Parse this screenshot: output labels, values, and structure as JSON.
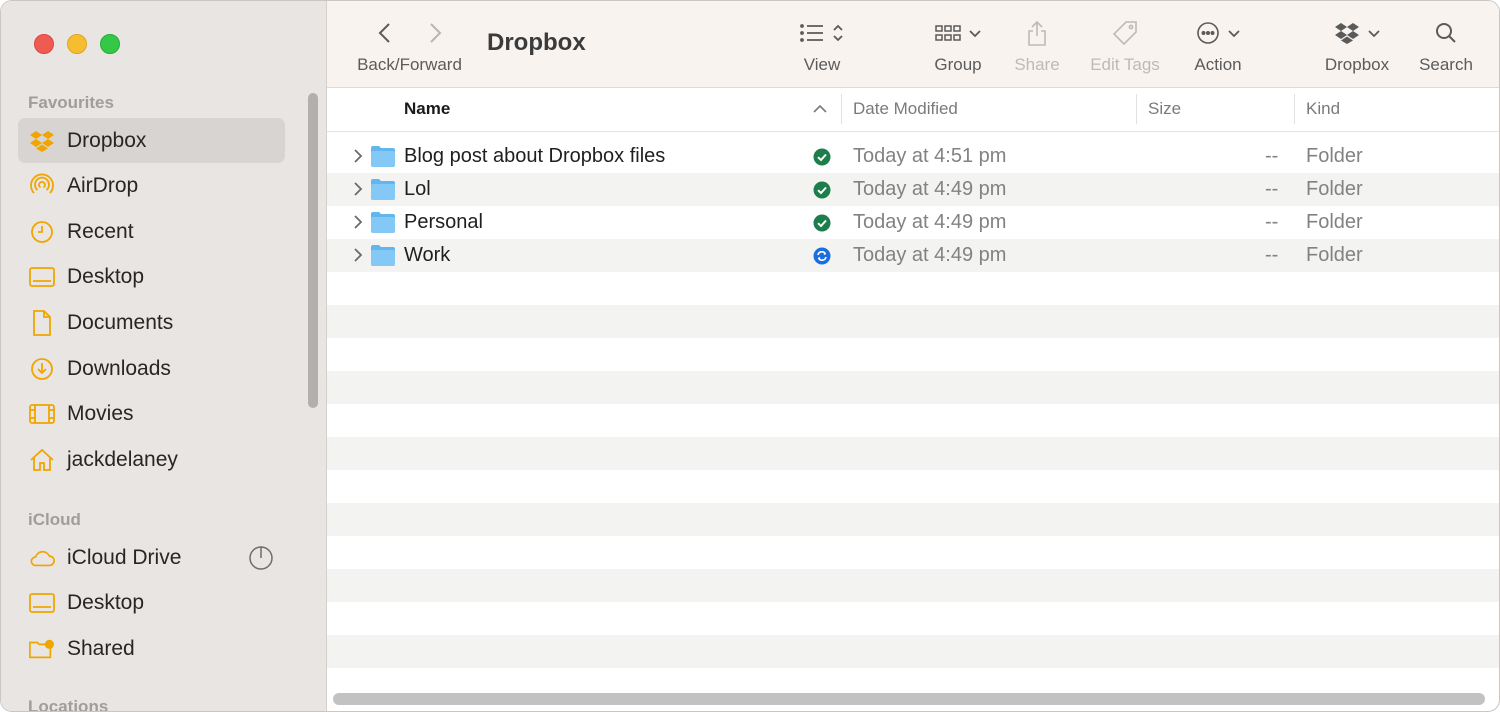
{
  "window": {
    "title": "Dropbox"
  },
  "sidebar": {
    "favourites_title": "Favourites",
    "favourites": [
      {
        "label": "Dropbox",
        "icon": "dropbox-icon",
        "selected": true
      },
      {
        "label": "AirDrop",
        "icon": "airdrop-icon"
      },
      {
        "label": "Recent",
        "icon": "clock-icon"
      },
      {
        "label": "Desktop",
        "icon": "desktop-icon"
      },
      {
        "label": "Documents",
        "icon": "document-icon"
      },
      {
        "label": "Downloads",
        "icon": "download-icon"
      },
      {
        "label": "Movies",
        "icon": "film-icon"
      },
      {
        "label": "jackdelaney",
        "icon": "home-icon"
      }
    ],
    "icloud_title": "iCloud",
    "icloud": [
      {
        "label": "iCloud Drive",
        "icon": "cloud-icon"
      },
      {
        "label": "Desktop",
        "icon": "desktop-icon"
      },
      {
        "label": "Shared",
        "icon": "shared-folder-icon"
      }
    ],
    "locations_title": "Locations"
  },
  "toolbar": {
    "back_forward": "Back/Forward",
    "view": "View",
    "group": "Group",
    "share": "Share",
    "edit_tags": "Edit Tags",
    "action": "Action",
    "dropbox": "Dropbox",
    "search": "Search"
  },
  "columns": {
    "name": "Name",
    "date": "Date Modified",
    "size": "Size",
    "kind": "Kind"
  },
  "files": [
    {
      "name": "Blog post about Dropbox files",
      "status": "synced",
      "date": "Today at 4:51 pm",
      "size": "--",
      "kind": "Folder"
    },
    {
      "name": "Lol",
      "status": "synced",
      "date": "Today at 4:49 pm",
      "size": "--",
      "kind": "Folder"
    },
    {
      "name": "Personal",
      "status": "synced",
      "date": "Today at 4:49 pm",
      "size": "--",
      "kind": "Folder"
    },
    {
      "name": "Work",
      "status": "syncing",
      "date": "Today at 4:49 pm",
      "size": "--",
      "kind": "Folder"
    }
  ],
  "colors": {
    "accent_folder": "#5bb3ef",
    "synced": "#1e7e4b",
    "syncing": "#1a6fe0",
    "sidebar_icon": "#f0a500"
  }
}
